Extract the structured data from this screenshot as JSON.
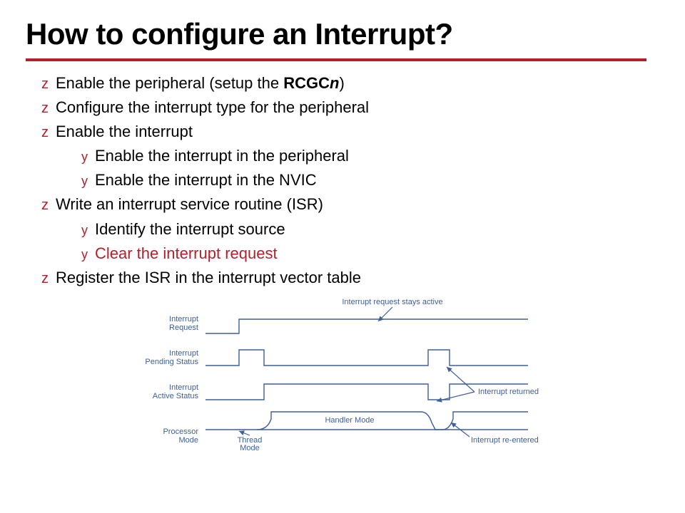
{
  "title": "How to configure an Interrupt?",
  "bullets": {
    "b1a": "Enable the peripheral (setup the ",
    "b1b": "RCGC",
    "b1c": "n",
    "b1d": ")",
    "b2": "Configure the interrupt type for the peripheral",
    "b3": "Enable the interrupt",
    "b3a": "Enable the interrupt in the peripheral",
    "b3b": "Enable the interrupt in the NVIC",
    "b4": "Write an interrupt service routine (ISR)",
    "b4a": "Identify the interrupt source",
    "b4b": "Clear the interrupt request",
    "b5": "Register the ISR in the interrupt vector table"
  },
  "diagram": {
    "l1": "Interrupt",
    "l1b": "Request",
    "l2": "Interrupt",
    "l2b": "Pending Status",
    "l3": "Interrupt",
    "l3b": "Active Status",
    "l4": "Processor",
    "l4b": "Mode",
    "top": "Interrupt request stays active",
    "thread": "Thread",
    "mode": "Mode",
    "handler": "Handler Mode",
    "ret": "Interrupt returned",
    "reent": "Interrupt re-entered"
  }
}
